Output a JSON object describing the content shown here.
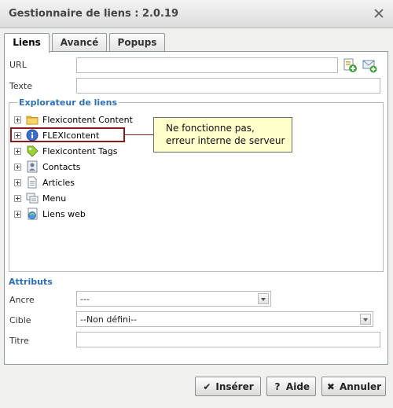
{
  "window": {
    "title": "Gestionnaire de liens : 2.0.19"
  },
  "tabs": [
    {
      "label": "Liens",
      "active": true
    },
    {
      "label": "Avancé",
      "active": false
    },
    {
      "label": "Popups",
      "active": false
    }
  ],
  "form": {
    "url_label": "URL",
    "url_value": "",
    "texte_label": "Texte",
    "texte_value": ""
  },
  "browser": {
    "legend": "Explorateur de liens",
    "items": [
      {
        "label": "Flexicontent Content",
        "icon": "folder-icon"
      },
      {
        "label": "FLEXIcontent",
        "icon": "info-icon"
      },
      {
        "label": "Flexicontent Tags",
        "icon": "tag-icon"
      },
      {
        "label": "Contacts",
        "icon": "contacts-icon"
      },
      {
        "label": "Articles",
        "icon": "article-icon"
      },
      {
        "label": "Menu",
        "icon": "menu-icon"
      },
      {
        "label": "Liens web",
        "icon": "globe-icon"
      }
    ]
  },
  "annotation": {
    "line1": "Ne fonctionne pas,",
    "line2": "erreur interne de serveur"
  },
  "attributes": {
    "heading": "Attributs",
    "ancre_label": "Ancre",
    "ancre_value": "---",
    "cible_label": "Cible",
    "cible_value": "--Non défini--",
    "titre_label": "Titre",
    "titre_value": ""
  },
  "buttons": {
    "insert": "Insérer",
    "help": "Aide",
    "cancel": "Annuler"
  },
  "colors": {
    "accent": "#2b6fb6",
    "highlight": "#8b1a1a",
    "note_bg": "#ffffcc"
  }
}
